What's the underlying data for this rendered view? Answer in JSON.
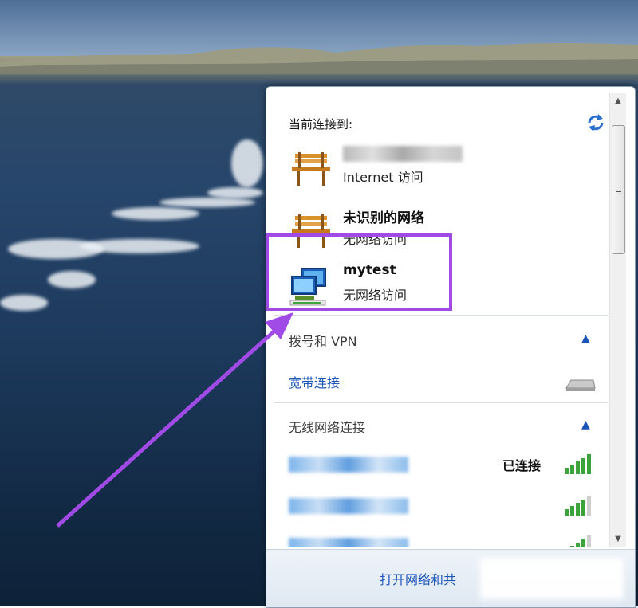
{
  "popup": {
    "header": "当前连接到:",
    "networks": [
      {
        "name": "",
        "status": "Internet 访问",
        "icon": "bench-network-icon",
        "blurred": true
      },
      {
        "name": "未识别的网络",
        "status": "无网络访问",
        "icon": "bench-network-icon"
      },
      {
        "name": "mytest",
        "status": "无网络访问",
        "icon": "computer-network-icon"
      }
    ],
    "dialup_section": "拨号和 VPN",
    "broadband_link": "宽带连接",
    "wireless_section": "无线网络连接",
    "wifi": [
      {
        "name": "",
        "status": "已连接",
        "signal": 5,
        "blurred": true
      },
      {
        "name": "",
        "status": "",
        "signal": 4,
        "blurred": true
      },
      {
        "name": "",
        "status": "",
        "signal": 4,
        "blurred": true
      }
    ],
    "footer_link": "打开网络和共"
  },
  "colors": {
    "highlight": "#a14be6",
    "link": "#1e57b8"
  }
}
